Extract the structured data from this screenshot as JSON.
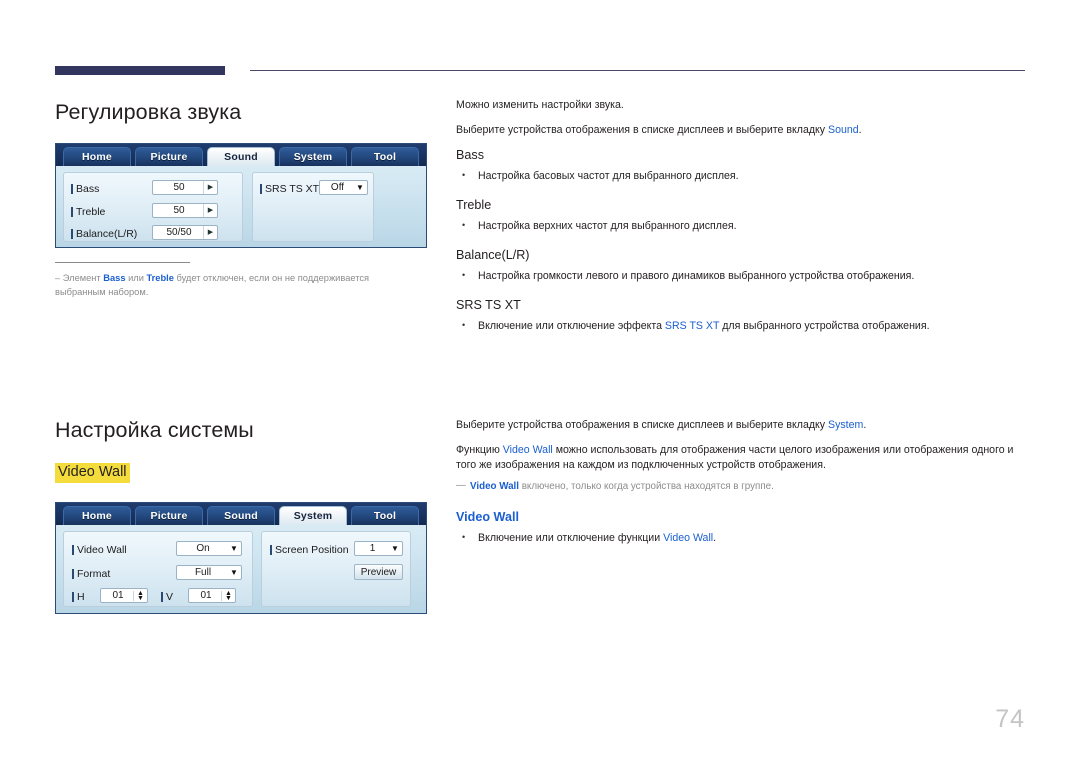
{
  "page": {
    "number": "74"
  },
  "sections": {
    "sound": {
      "title": "Регулировка звука",
      "osd": {
        "tabs": [
          {
            "label": "Home",
            "active": false
          },
          {
            "label": "Picture",
            "active": false
          },
          {
            "label": "Sound",
            "active": true
          },
          {
            "label": "System",
            "active": false
          },
          {
            "label": "Tool",
            "active": false
          }
        ],
        "rows": [
          {
            "label": "Bass",
            "value": "50"
          },
          {
            "label": "Treble",
            "value": "50"
          },
          {
            "label": "Balance(L/R)",
            "value": "50/50"
          }
        ],
        "right": {
          "label": "SRS TS XT",
          "value": "Off"
        }
      },
      "note": {
        "pre": "Элемент ",
        "b1": "Bass",
        "mid": " или ",
        "b2": "Treble",
        "post": " будет отключен, если он не поддерживается выбранным набором."
      },
      "intro1": "Можно изменить настройки звука.",
      "intro2_pre": "Выберите устройства отображения в списке дисплеев и выберите вкладку ",
      "intro2_link": "Sound",
      "intro2_post": ".",
      "items": [
        {
          "head": "Bass",
          "bullets": [
            {
              "text": "Настройка басовых частот для выбранного дисплея."
            }
          ]
        },
        {
          "head": "Treble",
          "bullets": [
            {
              "text": "Настройка верхних частот для выбранного дисплея."
            }
          ]
        },
        {
          "head": "Balance(L/R)",
          "bullets": [
            {
              "text": "Настройка громкости левого и правого динамиков выбранного устройства отображения."
            }
          ]
        },
        {
          "head": "SRS TS XT",
          "bullets": [
            {
              "pre": "Включение или отключение эффекта ",
              "link": "SRS TS XT",
              "post": " для выбранного устройства отображения."
            }
          ]
        }
      ]
    },
    "system": {
      "title": "Настройка системы",
      "highlight": "Video Wall",
      "osd": {
        "tabs": [
          {
            "label": "Home",
            "active": false
          },
          {
            "label": "Picture",
            "active": false
          },
          {
            "label": "Sound",
            "active": false
          },
          {
            "label": "System",
            "active": true
          },
          {
            "label": "Tool",
            "active": false
          }
        ],
        "left": {
          "video_wall_label": "Video Wall",
          "video_wall_value": "On",
          "format_label": "Format",
          "format_value": "Full",
          "h_label": "H",
          "h_value": "01",
          "v_label": "V",
          "v_value": "01"
        },
        "right": {
          "screen_position_label": "Screen Position",
          "screen_position_value": "1",
          "preview_button": "Preview"
        }
      },
      "intro1_pre": "Выберите устройства отображения в списке дисплеев и выберите вкладку ",
      "intro1_link": "System",
      "intro1_post": ".",
      "intro2_pre": "Функцию ",
      "intro2_link": "Video Wall",
      "intro2_post": " можно использовать для отображения части целого изображения или отображения одного и того же изображения на каждом из подключенных устройств отображения.",
      "note_link": "Video Wall",
      "note_post": " включено, только когда устройства находятся в группе.",
      "head": "Video Wall",
      "bullet_pre": "Включение или отключение функции ",
      "bullet_link": "Video Wall",
      "bullet_post": "."
    }
  },
  "colors": {
    "accent_blue": "#1a5fd0",
    "header_bar": "#32355e",
    "highlight_yellow": "#f4dc3c",
    "osd_tab_dark": "#1b3563",
    "page_num_gray": "#c4c4c4"
  }
}
